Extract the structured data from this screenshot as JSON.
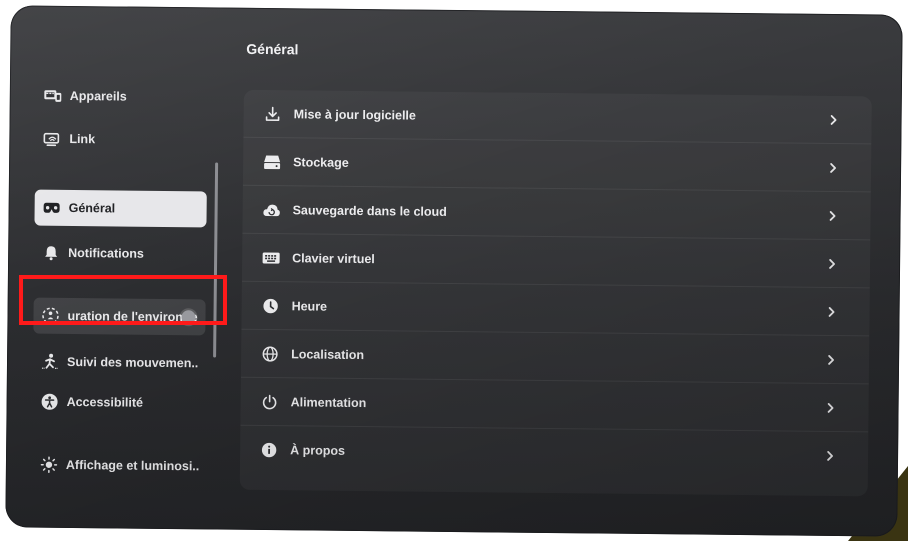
{
  "main": {
    "title": "Général",
    "rows": [
      {
        "label": "Mise à jour logicielle",
        "icon": "download-icon"
      },
      {
        "label": "Stockage",
        "icon": "storage-icon"
      },
      {
        "label": "Sauvegarde dans le cloud",
        "icon": "cloud-backup-icon"
      },
      {
        "label": "Clavier virtuel",
        "icon": "keyboard-icon"
      },
      {
        "label": "Heure",
        "icon": "clock-icon"
      },
      {
        "label": "Localisation",
        "icon": "globe-icon"
      },
      {
        "label": "Alimentation",
        "icon": "power-icon"
      },
      {
        "label": "À propos",
        "icon": "info-icon"
      }
    ]
  },
  "sidebar": {
    "items": [
      {
        "label": "Appareils",
        "icon": "devices-icon"
      },
      {
        "label": "Link",
        "icon": "link-icon"
      },
      {
        "label": "Général",
        "icon": "headset-icon",
        "state": "selected"
      },
      {
        "label": "Notifications",
        "icon": "bell-icon"
      },
      {
        "label": "uration de l'environne",
        "icon": "boundary-icon",
        "state": "focused"
      },
      {
        "label": "Suivi des mouvemen..",
        "icon": "movement-icon"
      },
      {
        "label": "Accessibilité",
        "icon": "accessibility-icon"
      },
      {
        "label": "Affichage et luminosi..",
        "icon": "brightness-icon"
      }
    ]
  },
  "colors": {
    "highlight": "#ff1a1a",
    "panel": "#2c2d30",
    "selected_bg": "#e7e7ea"
  }
}
